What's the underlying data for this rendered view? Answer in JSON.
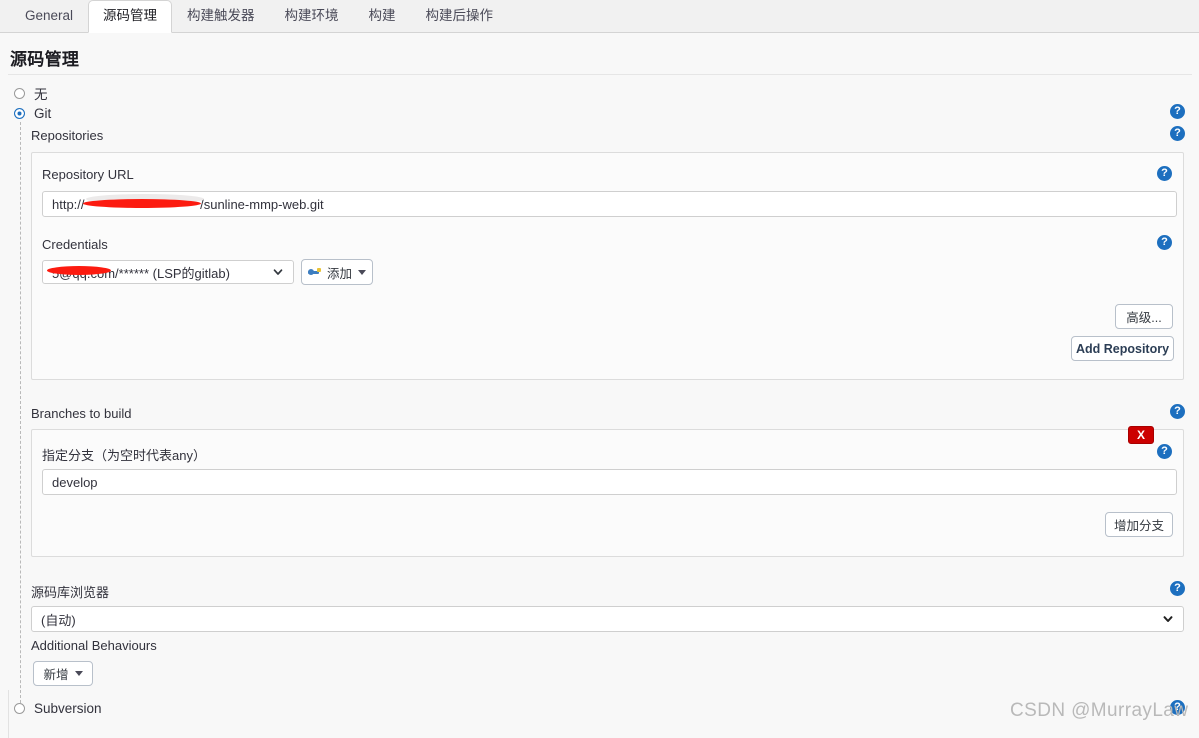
{
  "tabs": [
    {
      "label": "General",
      "active": false
    },
    {
      "label": "源码管理",
      "active": true
    },
    {
      "label": "构建触发器",
      "active": false
    },
    {
      "label": "构建环境",
      "active": false
    },
    {
      "label": "构建",
      "active": false
    },
    {
      "label": "构建后操作",
      "active": false
    }
  ],
  "section": {
    "title": "源码管理"
  },
  "scm_options": {
    "none_label": "无",
    "git_label": "Git",
    "subversion_label": "Subversion",
    "selected": "Git"
  },
  "git": {
    "repositories_label": "Repositories",
    "repository_url_label": "Repository URL",
    "repository_url_value": "http://                                /sunline-mmp-web.git",
    "credentials_label": "Credentials",
    "credentials_value": "                   5@qq.com/****** (LSP的gitlab)",
    "add_credentials_label": "添加",
    "advanced_label": "高级...",
    "add_repository_label": "Add Repository",
    "branches_label": "Branches to build",
    "branch_specifier_label": "指定分支（为空时代表any）",
    "branch_value": "develop",
    "delete_branch_label": "X",
    "add_branch_label": "增加分支",
    "repo_browser_label": "源码库浏览器",
    "repo_browser_value": "(自动)",
    "additional_behaviours_label": "Additional Behaviours",
    "add_behaviour_label": "新增"
  },
  "icons": {
    "help": "?",
    "chevron_down": "⌄",
    "key": "key-icon"
  },
  "watermark": {
    "text": "CSDN @MurrayLaw"
  },
  "colors": {
    "accent_blue": "#1d6fbf",
    "danger_red": "#cc0000",
    "redaction_red": "#fc1b10",
    "page_bg": "#f8f8f8",
    "panel_bg": "#fbfbfb"
  }
}
